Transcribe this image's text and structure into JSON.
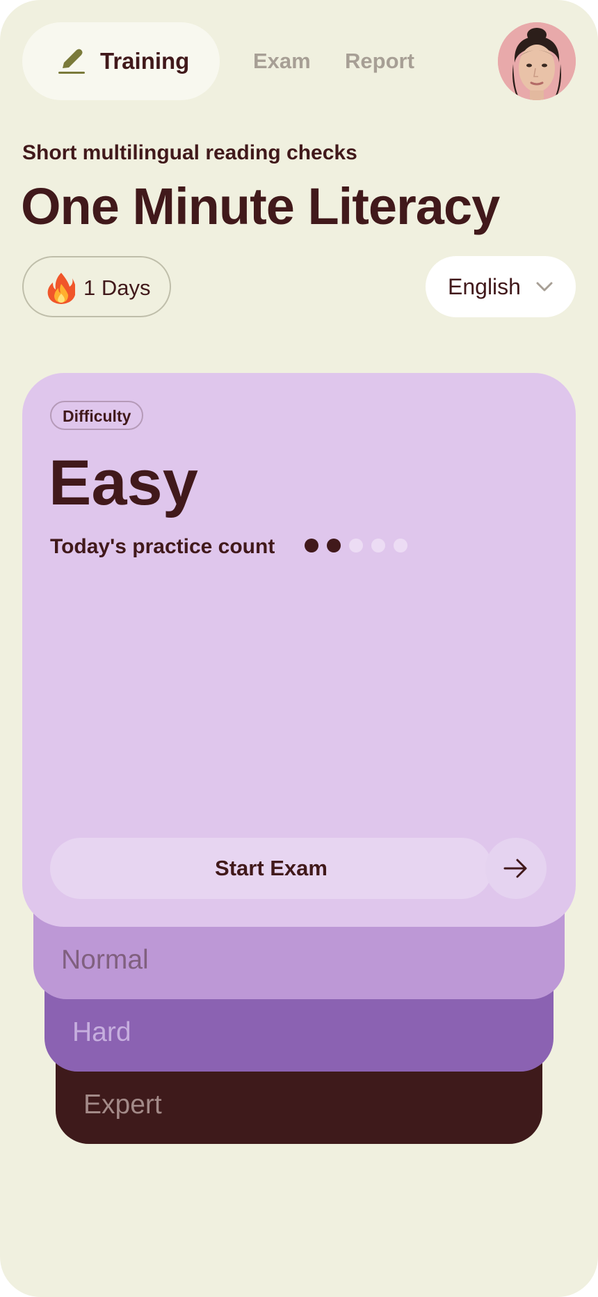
{
  "nav": {
    "tabs": [
      {
        "label": "Training",
        "active": true,
        "icon": "pen-icon"
      },
      {
        "label": "Exam",
        "active": false
      },
      {
        "label": "Report",
        "active": false
      }
    ],
    "avatar": "user-avatar"
  },
  "header": {
    "subtitle": "Short multilingual reading checks",
    "title": "One Minute Literacy"
  },
  "streak": {
    "icon": "fire-icon",
    "label": "1 Days"
  },
  "language": {
    "selected": "English",
    "icon": "chevron-down-icon"
  },
  "difficulty_card": {
    "badge": "Difficulty",
    "level": "Easy",
    "practice_label": "Today's practice count",
    "practice_done": 2,
    "practice_total": 5,
    "start_label": "Start Exam",
    "start_icon": "arrow-right-icon"
  },
  "other_levels": [
    "Normal",
    "Hard",
    "Expert"
  ],
  "colors": {
    "background": "#f0f0df",
    "text": "#41191b",
    "card_easy": "#dfc6ec",
    "card_normal": "#bd98d6",
    "card_hard": "#8b62b2",
    "card_expert": "#3e1a1b",
    "dot_done": "#41191b",
    "dot_pending": "#ecdcf4"
  }
}
